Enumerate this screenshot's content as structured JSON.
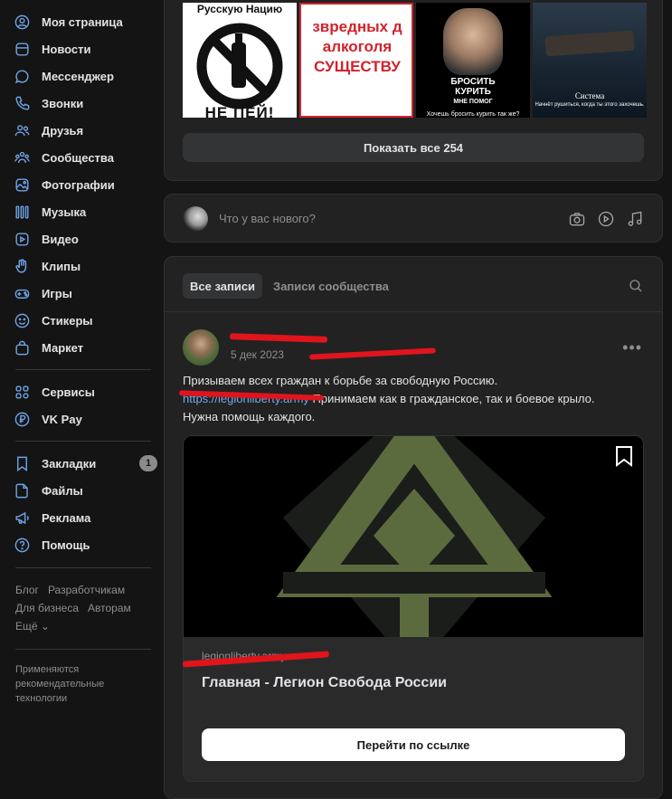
{
  "sidebar": {
    "items": [
      {
        "label": "Моя страница",
        "icon": "user-circle-icon"
      },
      {
        "label": "Новости",
        "icon": "newspaper-icon"
      },
      {
        "label": "Мессенджер",
        "icon": "chat-bubble-icon"
      },
      {
        "label": "Звонки",
        "icon": "phone-icon"
      },
      {
        "label": "Друзья",
        "icon": "friends-icon"
      },
      {
        "label": "Сообщества",
        "icon": "communities-icon"
      },
      {
        "label": "Фотографии",
        "icon": "photo-icon"
      },
      {
        "label": "Музыка",
        "icon": "music-icon"
      },
      {
        "label": "Видео",
        "icon": "video-icon"
      },
      {
        "label": "Клипы",
        "icon": "clips-icon"
      },
      {
        "label": "Игры",
        "icon": "gamepad-icon"
      },
      {
        "label": "Стикеры",
        "icon": "smile-icon"
      },
      {
        "label": "Маркет",
        "icon": "shopping-bag-icon"
      }
    ],
    "services": [
      {
        "label": "Сервисы",
        "icon": "grid-icon"
      },
      {
        "label": "VK Pay",
        "icon": "ruble-icon"
      }
    ],
    "extra": [
      {
        "label": "Закладки",
        "icon": "bookmark-icon",
        "badge": "1"
      },
      {
        "label": "Файлы",
        "icon": "file-icon"
      },
      {
        "label": "Реклама",
        "icon": "megaphone-icon"
      },
      {
        "label": "Помощь",
        "icon": "help-icon"
      }
    ],
    "footer": {
      "blog": "Блог",
      "developers": "Разработчикам",
      "business": "Для бизнеса",
      "authors": "Авторам",
      "more": "Ещё ⌄"
    },
    "recommend_note": "Применяются рекомендательные технологии"
  },
  "photos": {
    "tiles": [
      {
        "top_text": "Русскую Нацию",
        "bottom_text": "НЕ ПЕЙ!"
      },
      {
        "lines": [
          "звредных д",
          "алкоголя",
          "СУЩЕСТВУ"
        ]
      },
      {
        "lines": [
          "БРОСИТЬ",
          "КУРИТЬ",
          "МНЕ ПОМОГ",
          "Хочешь бросить курить так же?"
        ]
      },
      {
        "lines": [
          "Система",
          "Начнёт рушиться, когда ты этого захочешь."
        ]
      }
    ],
    "show_all": "Показать все 254"
  },
  "compose": {
    "placeholder": "Что у вас нового?"
  },
  "wall": {
    "tabs": [
      "Все записи",
      "Записи сообщества"
    ],
    "post": {
      "date": "5 дек 2023",
      "more": "•••",
      "line1": "Призываем всех граждан к борьбе за свободную Россию.",
      "line2_link": "https://legionliberty.army",
      "line2_rest": " Принимаем как в гражданское, так и боевое крыло.",
      "line3": "Нужна помощь каждого.",
      "attachment": {
        "domain": "legionliberty.army",
        "title": "Главная - Легион Свобода России",
        "button": "Перейти по ссылке"
      }
    }
  }
}
